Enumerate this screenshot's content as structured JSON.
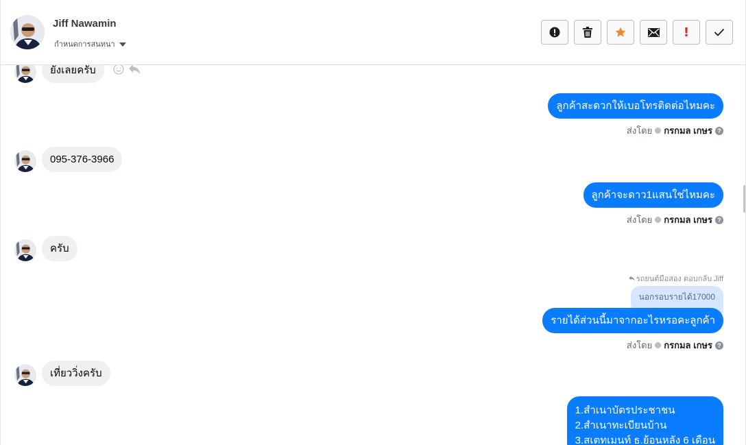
{
  "header": {
    "name": "Jiff Nawamin",
    "subtitle": "กำหนดการสนทนา"
  },
  "toolbar": [
    {
      "icon": "alert-circle-icon",
      "label": ""
    },
    {
      "icon": "trash-icon",
      "label": ""
    },
    {
      "icon": "star-icon",
      "label": ""
    },
    {
      "icon": "mail-icon",
      "label": ""
    },
    {
      "icon": "exclamation-icon",
      "label": "!"
    },
    {
      "icon": "check-icon",
      "label": ""
    }
  ],
  "colors": {
    "outgoing_bubble": "#0a7cff",
    "incoming_bubble": "#f0f0f0",
    "star": "#f5862a",
    "exclamation": "#e02424"
  },
  "messages": {
    "m1": {
      "text": "ยังเลยครับ"
    },
    "m2": {
      "text": "ลูกค้าสะดวกให้เบอโทรติดต่อไหมคะ"
    },
    "m3": {
      "text": "095-376-3966"
    },
    "m4": {
      "text": "ลูกค้าจะดาว1แสนใช่ไหมคะ"
    },
    "m5": {
      "text": "ครับ"
    },
    "m6": {
      "reply_to": "รถยนต์มือสอง ตอบกลับ Jiff",
      "quoted": "นอกรอบรายได้17000",
      "text": "รายได้ส่วนนี้มาจากอะไรหรอคะลูกค้า"
    },
    "m7": {
      "text": "เที่ยววิ่งครับ"
    },
    "m8": {
      "lines": [
        "1.สำเนาบัตรประชาชน",
        "2.สำเนาทะเบียนบ้าน",
        "3.สเตทเมนท์ ธ.ย้อนหลัง 6 เดือน"
      ]
    }
  },
  "meta": {
    "sent_by_label": "ส่งโดย",
    "sender": "กรกมล เกษร"
  }
}
